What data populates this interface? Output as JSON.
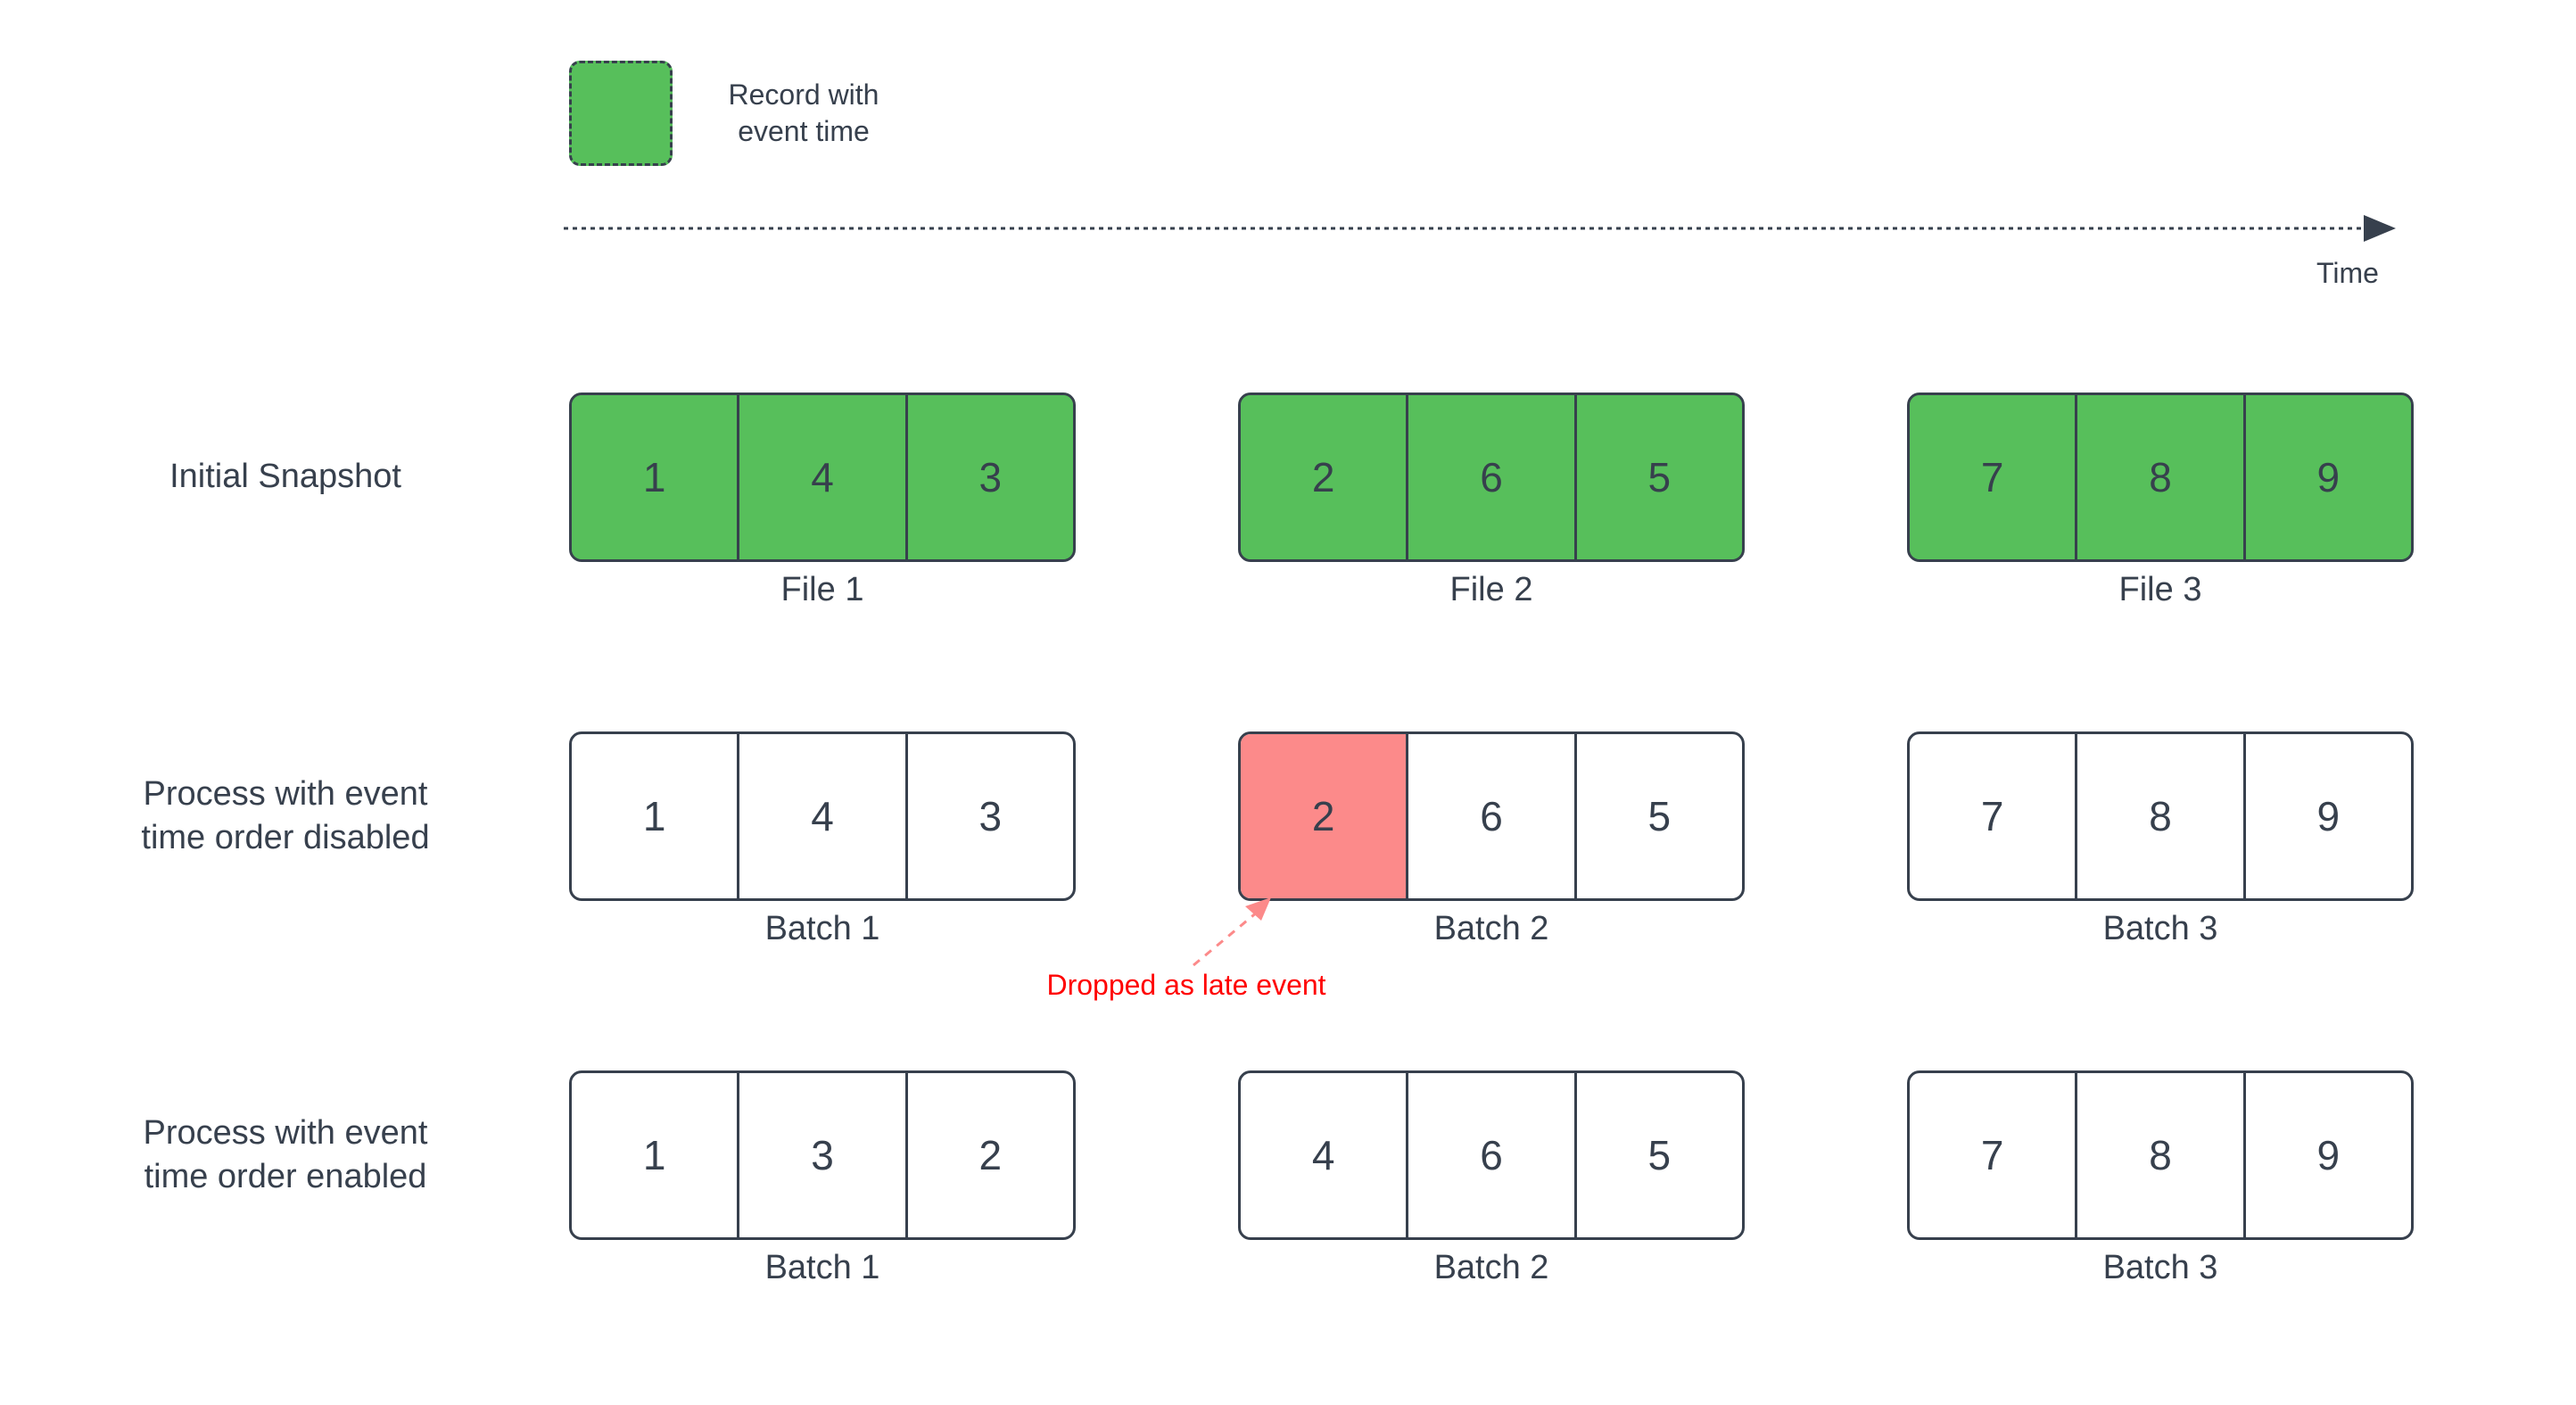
{
  "legend": {
    "swatch_icon": "record-swatch-icon",
    "swatch_color": "#57bf5b",
    "label": "Record with\nevent time"
  },
  "time_axis": {
    "label": "Time",
    "arrow_icon": "arrow-right-icon",
    "line_style": "dotted",
    "color": "#37404d"
  },
  "colors": {
    "record_green": "#57bf5b",
    "dropped_red": "#fc8a8a",
    "annotation_red": "#ff0000",
    "stroke": "#37404d",
    "background": "#ffffff"
  },
  "annotation": {
    "text": "Dropped as late event",
    "color": "#ff0000",
    "arrow_icon": "dashed-arrow-up-right-icon"
  },
  "rows": [
    {
      "id": "initial-snapshot",
      "label": "Initial Snapshot",
      "style": "green",
      "groups": [
        {
          "caption": "File 1",
          "cells": [
            {
              "value": "1",
              "state": "normal"
            },
            {
              "value": "4",
              "state": "normal"
            },
            {
              "value": "3",
              "state": "normal"
            }
          ]
        },
        {
          "caption": "File 2",
          "cells": [
            {
              "value": "2",
              "state": "normal"
            },
            {
              "value": "6",
              "state": "normal"
            },
            {
              "value": "5",
              "state": "normal"
            }
          ]
        },
        {
          "caption": "File 3",
          "cells": [
            {
              "value": "7",
              "state": "normal"
            },
            {
              "value": "8",
              "state": "normal"
            },
            {
              "value": "9",
              "state": "normal"
            }
          ]
        }
      ]
    },
    {
      "id": "event-time-order-disabled",
      "label": "Process with event\ntime order disabled",
      "style": "plain",
      "groups": [
        {
          "caption": "Batch 1",
          "cells": [
            {
              "value": "1",
              "state": "normal"
            },
            {
              "value": "4",
              "state": "normal"
            },
            {
              "value": "3",
              "state": "normal"
            }
          ]
        },
        {
          "caption": "Batch 2",
          "cells": [
            {
              "value": "2",
              "state": "dropped"
            },
            {
              "value": "6",
              "state": "normal"
            },
            {
              "value": "5",
              "state": "normal"
            }
          ]
        },
        {
          "caption": "Batch 3",
          "cells": [
            {
              "value": "7",
              "state": "normal"
            },
            {
              "value": "8",
              "state": "normal"
            },
            {
              "value": "9",
              "state": "normal"
            }
          ]
        }
      ]
    },
    {
      "id": "event-time-order-enabled",
      "label": "Process with event\ntime order enabled",
      "style": "plain",
      "groups": [
        {
          "caption": "Batch 1",
          "cells": [
            {
              "value": "1",
              "state": "normal"
            },
            {
              "value": "3",
              "state": "normal"
            },
            {
              "value": "2",
              "state": "normal"
            }
          ]
        },
        {
          "caption": "Batch 2",
          "cells": [
            {
              "value": "4",
              "state": "normal"
            },
            {
              "value": "6",
              "state": "normal"
            },
            {
              "value": "5",
              "state": "normal"
            }
          ]
        },
        {
          "caption": "Batch 3",
          "cells": [
            {
              "value": "7",
              "state": "normal"
            },
            {
              "value": "8",
              "state": "normal"
            },
            {
              "value": "9",
              "state": "normal"
            }
          ]
        }
      ]
    }
  ]
}
